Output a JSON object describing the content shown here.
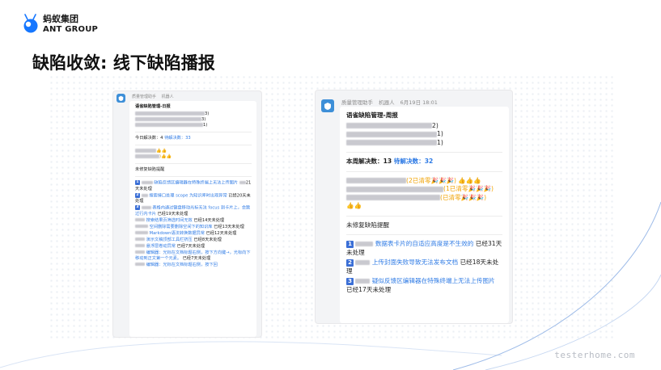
{
  "logo": {
    "cn": "蚂蚁集团",
    "en": "ANT GROUP"
  },
  "slide_title": "缺陷收敛: 线下缺陷播报",
  "left_screenshot": {
    "sender": "质量管理助手",
    "robot_tag": "机器人",
    "card_title": "语雀缺陷管理-日报",
    "list_suffixes": [
      "3)",
      "3)",
      "1)"
    ],
    "today_label": "今日解决数：",
    "today_value": "4",
    "pending_label": "待解决数：",
    "pending_value": "33",
    "reminder_title": "未修复缺陷提醒",
    "items": [
      {
        "n": "1",
        "text": "缺陷反馈区编辑器在特殊终端上无法上传图片",
        "tail": "21天未处理"
      },
      {
        "n": "2",
        "text": "搜索接口处理 scope 为知识库时出现异常",
        "tail": "已经20天未处理"
      },
      {
        "n": "3",
        "text": "表格内通过键盘移动光标无法 focus 到卡片上，会跳过行内卡片",
        "tail": "已经19天未处理"
      },
      {
        "n": "",
        "text": "搜索结果页筛选时间无效",
        "tail": "已经14天未处理"
      },
      {
        "n": "",
        "text": "空间删除需要删除空间下的知识库",
        "tail": "已经13天未处理"
      },
      {
        "n": "",
        "text": "Markdown语法转换数据异常",
        "tail": "已经12天未处理"
      },
      {
        "n": "",
        "text": "演示文稿顶部工具栏挤压",
        "tail": "已经8天未处理"
      },
      {
        "n": "",
        "text": "悬浮层卷动异常",
        "tail": "已经7天未处理"
      },
      {
        "n": "",
        "text": "编辑器：光标在文档标题右侧，按下方向键→，光标向下移动到正文第一个元素。",
        "tail": "已经7天未处理"
      },
      {
        "n": "",
        "text": "编辑器：光标在文档标题右侧，按下回",
        "tail": ""
      }
    ]
  },
  "right_screenshot": {
    "sender": "质量管理助手",
    "robot_tag": "机器人",
    "time": "6月19日 18:01",
    "card_title": "语雀缺陷管理-周报",
    "list_suffixes": [
      "2)",
      "1)",
      "1)"
    ],
    "week_label": "本周解决数：",
    "week_value": "13",
    "pending_label": "待解决数：",
    "pending_value": "32",
    "clear_lines": [
      "(2已清零🎉🎉🎉) 👍👍👍",
      "(1已清零🎉🎉🎉)",
      "(已清零🎉🎉🎉)"
    ],
    "reminder_title": "未修复缺陷提醒",
    "items": [
      {
        "n": "1",
        "text": "数据表卡片的自适应高度是不生效的",
        "tail": "已经31天未处理"
      },
      {
        "n": "2",
        "text": "上传封面失败导致无法发布文档",
        "tail": "已经18天未处理"
      },
      {
        "n": "3",
        "text": "疑似反馈区编辑器在特殊终端上无法上传图片",
        "tail": "已经17天未处理"
      }
    ]
  },
  "watermark": "testerhome.com",
  "colors": {
    "accent": "#2f7be5",
    "num_badge": "#3b6fd6",
    "avatar": "#3d8fd8"
  }
}
